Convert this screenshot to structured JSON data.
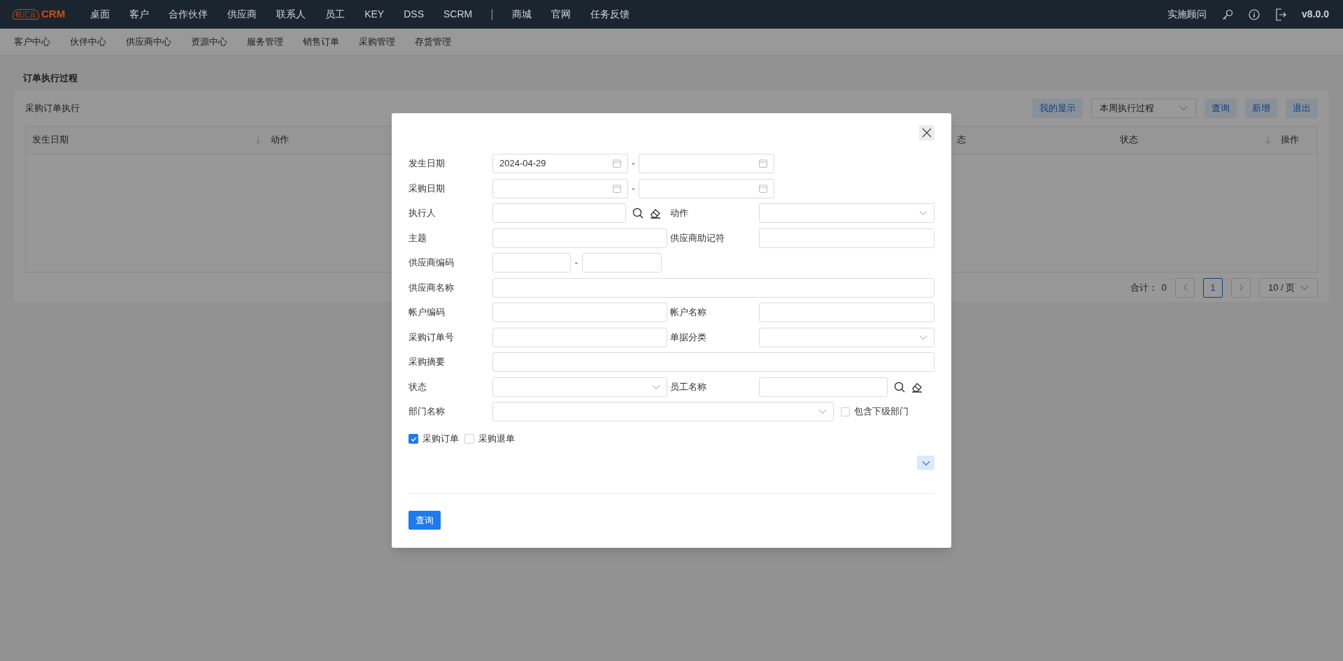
{
  "brand": {
    "badge": "机汇云",
    "name": "CRM"
  },
  "main_menu": [
    "桌面",
    "客户",
    "合作伙伴",
    "供应商",
    "联系人",
    "员工",
    "KEY",
    "DSS",
    "SCRM"
  ],
  "extra_menu": [
    "商城",
    "官网",
    "任务反馈"
  ],
  "user_menu": {
    "role": "实施顾问",
    "version": "v8.0.0"
  },
  "sub_menu": [
    "客户中心",
    "伙伴中心",
    "供应商中心",
    "资源中心",
    "服务管理",
    "销售订单",
    "采购管理",
    "存货管理"
  ],
  "page_title": "订单执行过程",
  "panel": {
    "title": "采购订单执行",
    "toolbar": [
      {
        "kind": "button",
        "label": "我的显示"
      },
      {
        "kind": "select",
        "value": "本周执行过程"
      },
      {
        "kind": "button",
        "label": "查询"
      },
      {
        "kind": "button",
        "label": "新增"
      },
      {
        "kind": "button",
        "label": "退出"
      }
    ]
  },
  "table": {
    "columns": [
      {
        "label": "发生日期",
        "sortable": true
      },
      {
        "label": "动作",
        "sortable": false
      },
      {
        "label": "态",
        "sortable": false
      },
      {
        "label": "状态",
        "sortable": true
      },
      {
        "label": "操作",
        "sortable": false
      }
    ]
  },
  "pagination": {
    "total_label": "合计：",
    "total": "0",
    "pages": [
      {
        "label": "1",
        "selected": true
      }
    ],
    "page_size": "10 / 页"
  },
  "dialog": {
    "rows": [
      {
        "kind": "date_range",
        "label": "发生日期",
        "from": "2024-04-29",
        "separator": "-"
      },
      {
        "kind": "date_range",
        "label": "采购日期",
        "separator": "-"
      },
      {
        "kind": "pair",
        "fields": [
          {
            "kind": "lookup",
            "label": "执行人"
          },
          {
            "kind": "select",
            "label": "动作"
          }
        ]
      },
      {
        "kind": "pair",
        "fields": [
          {
            "kind": "text",
            "label": "主题"
          },
          {
            "kind": "text",
            "label": "供应商助记符"
          }
        ]
      },
      {
        "kind": "range",
        "label": "供应商编码",
        "separator": "-"
      },
      {
        "kind": "wide",
        "label": "供应商名称"
      },
      {
        "kind": "pair",
        "fields": [
          {
            "kind": "text",
            "label": "帐户编码"
          },
          {
            "kind": "text",
            "label": "帐户名称"
          }
        ]
      },
      {
        "kind": "pair",
        "fields": [
          {
            "kind": "text",
            "label": "采购订单号"
          },
          {
            "kind": "select",
            "label": "单据分类"
          }
        ]
      },
      {
        "kind": "wide",
        "label": "采购摘要"
      },
      {
        "kind": "pair",
        "fields": [
          {
            "kind": "select",
            "label": "状态"
          },
          {
            "kind": "lookup",
            "label": "员工名称"
          }
        ]
      },
      {
        "kind": "tree_select",
        "label": "部门名称",
        "option": {
          "label": "包含下级部门",
          "checked": false
        }
      }
    ],
    "doc_types": [
      {
        "label": "采购订单",
        "checked": true
      },
      {
        "label": "采购退单",
        "checked": false
      }
    ],
    "submit": "查询"
  }
}
